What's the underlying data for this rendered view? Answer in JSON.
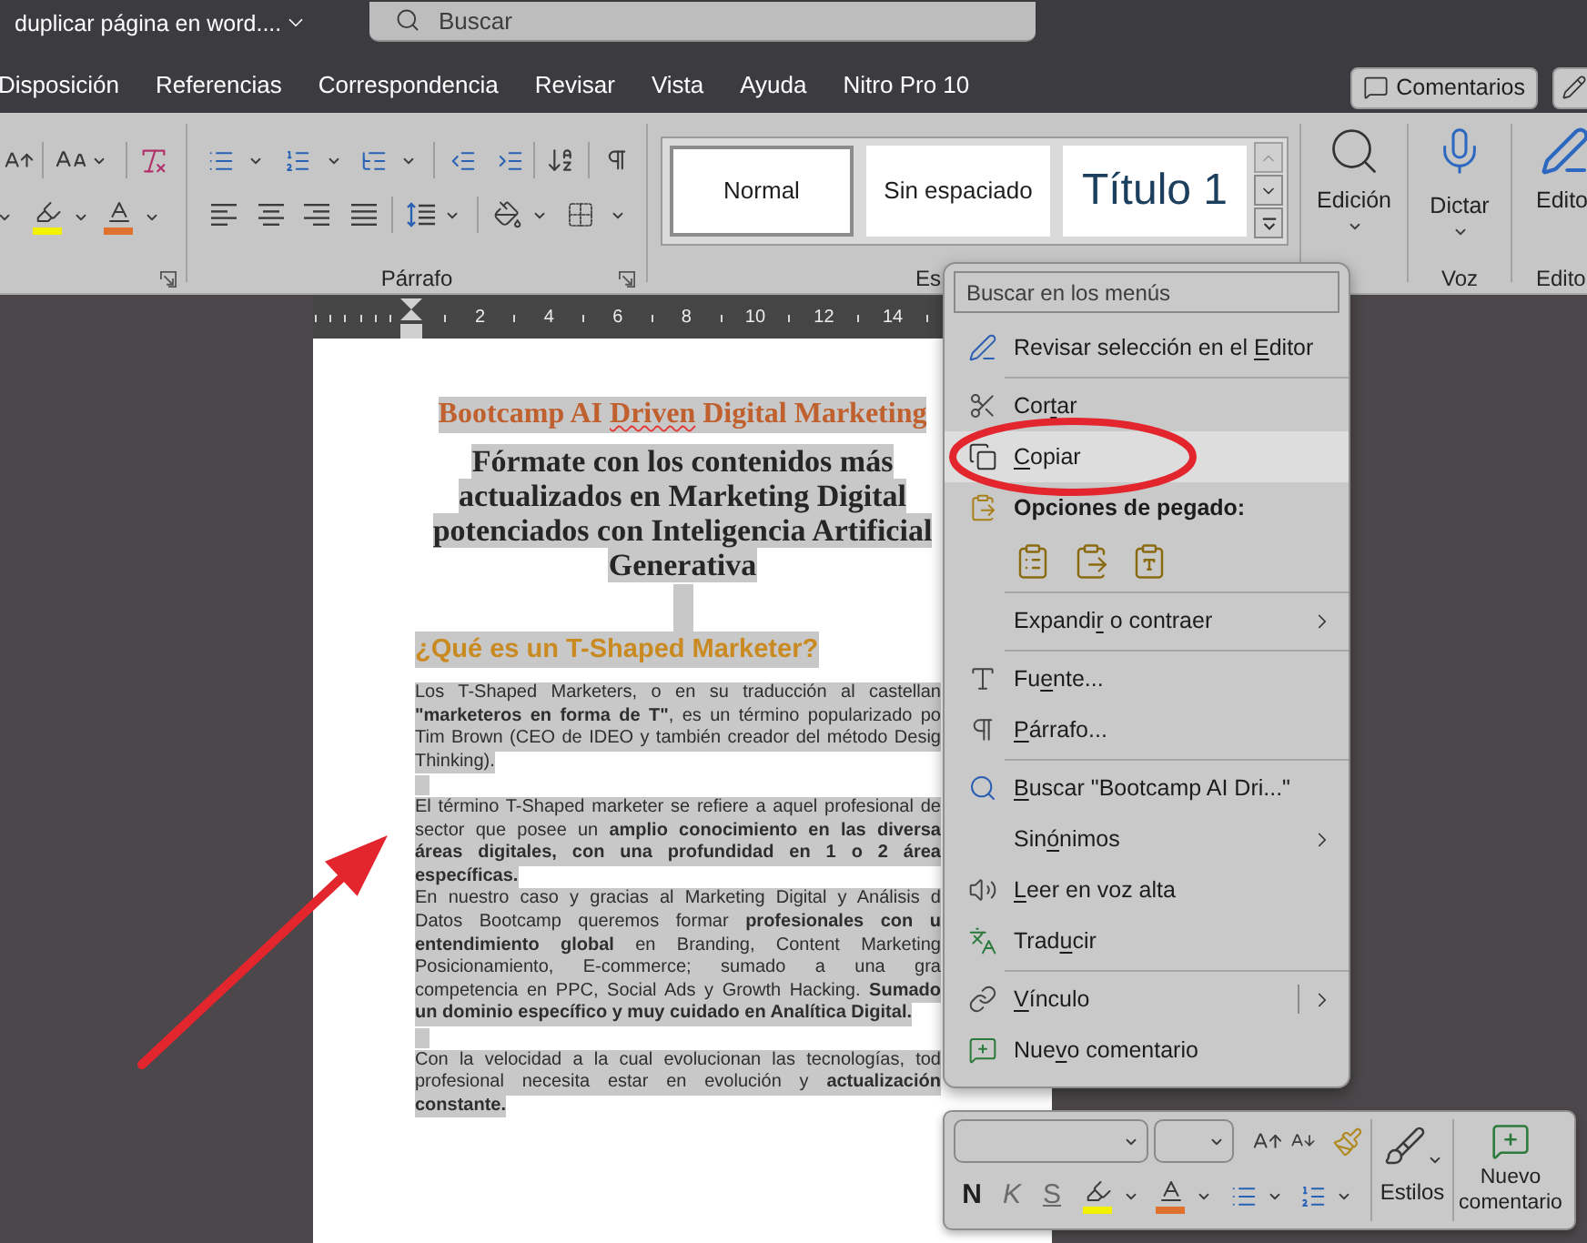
{
  "window": {
    "title": "duplicar página en word...."
  },
  "search": {
    "placeholder": "Buscar"
  },
  "tabs": [
    {
      "label": "Disposición",
      "selected": false
    },
    {
      "label": "Referencias",
      "selected": false
    },
    {
      "label": "Correspondencia",
      "selected": false
    },
    {
      "label": "Revisar",
      "selected": false
    },
    {
      "label": "Vista",
      "selected": false
    },
    {
      "label": "Ayuda",
      "selected": false
    },
    {
      "label": "Nitro Pro 10",
      "selected": false
    }
  ],
  "comments_button": {
    "label": "Comentarios"
  },
  "ribbon": {
    "font_group": {
      "color_buttons": [
        {
          "kind": "highlight",
          "color": "#f2f200"
        },
        {
          "kind": "font_color",
          "color": "#e0702e"
        }
      ]
    },
    "paragraph_group": {
      "label": "Párrafo"
    },
    "styles_group": {
      "label": "Es",
      "styles": [
        {
          "name": "Normal",
          "kind": "body",
          "selected": true
        },
        {
          "name": "Sin espaciado",
          "kind": "body",
          "selected": false
        },
        {
          "name": "Título 1",
          "kind": "heading",
          "selected": false
        }
      ],
      "scroll_up": {
        "disabled": true
      }
    },
    "editing_group": {
      "button": "Edición"
    },
    "voice_group": {
      "button": "Dictar",
      "label": "Voz"
    },
    "editor_group": {
      "button": "Edito",
      "label": "Edito"
    }
  },
  "ruler": {
    "numbers": [
      "2",
      "4",
      "6",
      "8",
      "10",
      "12",
      "14"
    ]
  },
  "document": {
    "selected": true,
    "blocks": [
      {
        "kind": "title",
        "words": [
          {
            "text": "Bootcamp AI",
            "misspelled": false
          },
          {
            "text": "Driven",
            "misspelled": true
          },
          {
            "text": "Digital Marketing",
            "misspelled": false
          }
        ]
      },
      {
        "kind": "subtitle",
        "lines": [
          "Fórmate con los contenidos más",
          "actualizados en Marketing Digital",
          "potenciados con Inteligencia Artificial",
          "Generativa"
        ]
      },
      {
        "kind": "gap"
      },
      {
        "kind": "heading",
        "text": "¿Qué es un T-Shaped Marketer?"
      },
      {
        "kind": "paragraph",
        "lines": [
          {
            "text": "Los T-Shaped Marketers, o en su traducción al castellan",
            "bold": false
          },
          {
            "text": "**\"marketeros en forma de T\"**, es un término popularizado po",
            "bold": false
          },
          {
            "text": "Tim Brown (CEO de IDEO y también creador del método Desig",
            "bold": false
          },
          {
            "text": "Thinking).",
            "bold": false
          }
        ]
      },
      {
        "kind": "blank"
      },
      {
        "kind": "paragraph",
        "lines": [
          {
            "text": "El término T-Shaped marketer se refiere a aquel profesional de",
            "bold": false
          },
          {
            "text": "sector que posee un **amplio conocimiento en las diversa**",
            "bold": false
          },
          {
            "text": "áreas digitales, con una profundidad en 1 o 2 área",
            "bold": true
          },
          {
            "text": "específicas.",
            "bold": true
          }
        ]
      },
      {
        "kind": "paragraph",
        "lines": [
          {
            "text": "En nuestro caso y gracias al Marketing Digital y Análisis d",
            "bold": false
          },
          {
            "text": "Datos Bootcamp queremos formar **profesionales con u**",
            "bold": false
          },
          {
            "text": "**entendimiento global** en Branding, Content Marketing",
            "bold": false
          },
          {
            "text": "Posicionamiento, E-commerce; sumado a una gra",
            "bold": false
          },
          {
            "text": "competencia en PPC, Social Ads y Growth Hacking. **Sumado**",
            "bold": false
          },
          {
            "text": "un dominio específico y muy cuidado en Analítica Digital.",
            "bold": true
          }
        ]
      },
      {
        "kind": "blank"
      },
      {
        "kind": "paragraph",
        "lines": [
          {
            "text": "Con la velocidad a la cual evolucionan las tecnologías, tod",
            "bold": false
          },
          {
            "text": "profesional necesita estar en evolución y **actualización**",
            "bold": false
          },
          {
            "text": "constante.",
            "bold": true
          }
        ]
      }
    ]
  },
  "context_menu": {
    "search": {
      "placeholder": "Buscar en los menús"
    },
    "groups": [
      [
        {
          "kind": "command",
          "label": {
            "pre": "Revisar selección en el ",
            "key": "E",
            "post": "ditor"
          },
          "selected": false
        }
      ],
      [
        {
          "kind": "command",
          "label": {
            "pre": "Cor",
            "key": "t",
            "post": "ar"
          },
          "selected": false
        },
        {
          "kind": "command",
          "label": {
            "key": "C",
            "post": "opiar"
          },
          "selected": true
        },
        {
          "kind": "header",
          "label": {
            "pre": "Opciones de pegado:"
          }
        },
        {
          "kind": "paste_options",
          "options": [
            {
              "kind": "keep_source"
            },
            {
              "kind": "merge"
            },
            {
              "kind": "text_only"
            }
          ]
        }
      ],
      [
        {
          "kind": "submenu",
          "label": {
            "pre": "Expandi",
            "key": "r",
            "post": " o contraer"
          },
          "selected": false
        }
      ],
      [
        {
          "kind": "command",
          "label": {
            "pre": "Fu",
            "key": "e",
            "post": "nte..."
          },
          "selected": false
        },
        {
          "kind": "command",
          "label": {
            "key": "P",
            "post": "árrafo..."
          },
          "selected": false
        }
      ],
      [
        {
          "kind": "command",
          "label": {
            "key": "B",
            "post": "uscar \"Bootcamp AI Dri...\""
          },
          "selected": false
        },
        {
          "kind": "submenu",
          "label": {
            "pre": "Sin",
            "key": "ó",
            "post": "nimos"
          },
          "selected": false
        },
        {
          "kind": "command",
          "label": {
            "key": "L",
            "post": "eer en voz alta"
          },
          "selected": false
        },
        {
          "kind": "command",
          "label": {
            "pre": "Trad",
            "key": "u",
            "post": "cir"
          },
          "selected": false
        }
      ],
      [
        {
          "kind": "split",
          "label": {
            "key": "V",
            "post": "ínculo"
          },
          "selected": false
        },
        {
          "kind": "command",
          "label": {
            "pre": "Nue",
            "key": "v",
            "post": "o comentario"
          },
          "selected": false
        }
      ]
    ]
  },
  "mini_toolbar": {
    "format_buttons": [
      {
        "label": "N",
        "kind": "bold"
      },
      {
        "label": "K",
        "kind": "italic"
      },
      {
        "label": "S",
        "kind": "underline"
      }
    ],
    "color_buttons": [
      {
        "kind": "highlight",
        "color": "#f2f200"
      },
      {
        "kind": "font_color",
        "color": "#e0702e"
      }
    ],
    "styles_button": "Estilos",
    "comment_button": "Nuevo comentario"
  }
}
